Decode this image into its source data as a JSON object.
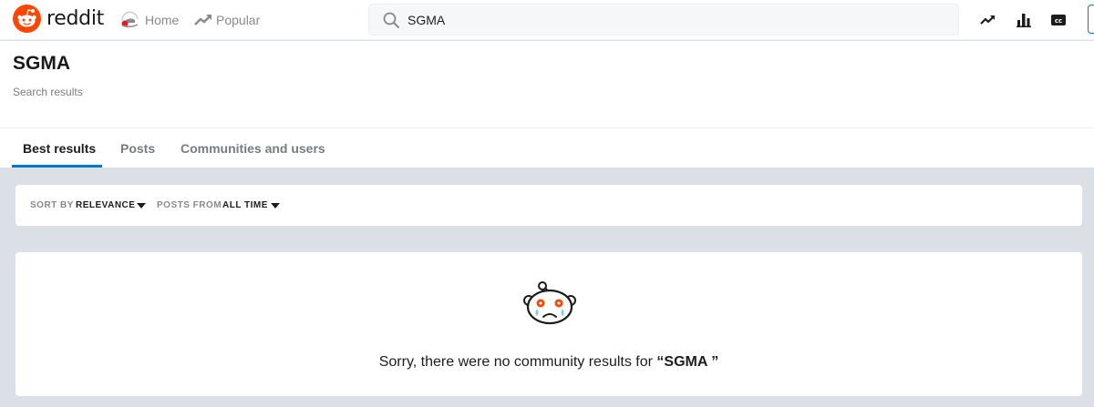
{
  "brand": {
    "wordmark": "reddit"
  },
  "nav": {
    "home_label": "Home",
    "popular_label": "Popular"
  },
  "search": {
    "value": "SGMA"
  },
  "header": {
    "title": "SGMA",
    "subtitle": "Search results"
  },
  "tabs": [
    {
      "label": "Best results",
      "active": true
    },
    {
      "label": "Posts",
      "active": false
    },
    {
      "label": "Communities and users",
      "active": false
    }
  ],
  "sort": {
    "sort_by_label": "SORT BY",
    "sort_by_value": "RELEVANCE",
    "posts_from_label": "POSTS FROM",
    "posts_from_value": "ALL TIME"
  },
  "empty_state": {
    "message_prefix": "Sorry, there were no community results for ",
    "query": "“SGMA ”"
  },
  "icons": [
    "reddit-logo-icon",
    "home-icon",
    "popular-icon",
    "search-icon",
    "trending-icon",
    "stats-icon",
    "closed-captions-icon",
    "sad-snoo-icon"
  ],
  "colors": {
    "brand": "#ff4500",
    "accent": "#0079d3",
    "page_bg": "#dae0e6"
  }
}
